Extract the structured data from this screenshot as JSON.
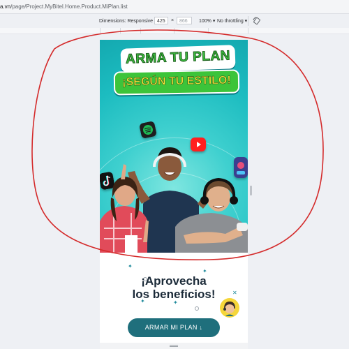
{
  "browser": {
    "url_host": "a.vn",
    "url_path": "/page/Project.MyBitel.Home.Product.MiPlan.list"
  },
  "devtools": {
    "dimensions_label": "Dimensions: Responsive ▾",
    "width_value": "425",
    "times": "×",
    "height_value": "866",
    "zoom": "100% ▾",
    "throttling": "No throttling ▾"
  },
  "banner": {
    "title_line1": "ARMA TU PLAN",
    "title_line2": "¡SEGÚN TU ESTILO!"
  },
  "section": {
    "headline_line1": "¡Aprovecha",
    "headline_line2": "los beneficios!",
    "cta_label": "ARMAR MI PLAN  ↓"
  },
  "colors": {
    "banner_teal": "#1ec0c3",
    "title_green": "#3cc43a",
    "cta_bg": "#1f6f7c",
    "annotation_red": "#d42a2a"
  },
  "icons": [
    "spotify-icon",
    "youtube-icon",
    "tiktok-icon",
    "app-icon",
    "rotate-icon",
    "arrow-down-icon",
    "assistant-avatar-icon"
  ]
}
